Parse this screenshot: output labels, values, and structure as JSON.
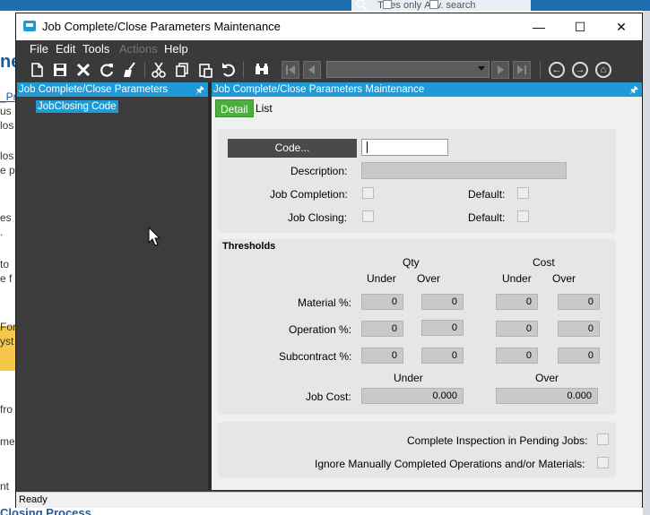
{
  "background": {
    "search_options": [
      "Titles only",
      "Adv. search"
    ],
    "left_fragments": [
      "ne",
      "_Pr",
      "us",
      "los",
      "los",
      "e p",
      "es",
      ".",
      " to",
      "e f",
      "For",
      "yst",
      " fro",
      "me",
      "nt"
    ],
    "bottom_text": "Closing Process"
  },
  "window": {
    "title": "Job Complete/Close Parameters Maintenance",
    "controls": {
      "minimize": "—",
      "maximize": "☐",
      "close": "✕"
    }
  },
  "menu": {
    "items": [
      {
        "label": "File",
        "enabled": true
      },
      {
        "label": "Edit",
        "enabled": true
      },
      {
        "label": "Tools",
        "enabled": true
      },
      {
        "label": "Actions",
        "enabled": false
      },
      {
        "label": "Help",
        "enabled": true
      }
    ]
  },
  "toolbar": {
    "icons": [
      "new-icon",
      "save-icon",
      "delete-icon",
      "refresh-icon",
      "clear-icon",
      "cut-icon",
      "copy-icon",
      "paste-icon",
      "undo-icon",
      "search-icon",
      "first-icon",
      "previous-icon",
      "navigation-combo",
      "next-icon",
      "last-icon",
      "back-icon",
      "forward-icon",
      "home-icon"
    ],
    "navigation_value": ""
  },
  "tree_panel": {
    "header": "Job Complete/Close Parameters",
    "items": [
      {
        "label": "JobClosing Code",
        "selected": true
      }
    ]
  },
  "detail_panel": {
    "header": "Job Complete/Close Parameters Maintenance",
    "tabs": [
      {
        "label": "Detail",
        "active": true
      },
      {
        "label": "List",
        "active": false
      }
    ],
    "code_button": "Code...",
    "code_value": "",
    "description_label": "Description:",
    "description_value": "",
    "job_completion_label": "Job Completion:",
    "job_closing_label": "Job Closing:",
    "default_label": "Default:",
    "thresholds": {
      "title": "Thresholds",
      "qty_label": "Qty",
      "cost_label": "Cost",
      "under_label": "Under",
      "over_label": "Over",
      "rows": [
        {
          "label": "Material %:",
          "qty_under": "0",
          "qty_over": "0",
          "cost_under": "0",
          "cost_over": "0"
        },
        {
          "label": "Operation %:",
          "qty_under": "0",
          "qty_over": "0",
          "cost_under": "0",
          "cost_over": "0"
        },
        {
          "label": "Subcontract %:",
          "qty_under": "0",
          "qty_over": "0",
          "cost_under": "0",
          "cost_over": "0"
        }
      ],
      "job_cost_label": "Job Cost:",
      "job_cost_under": "0.000",
      "job_cost_over": "0.000"
    },
    "options": {
      "complete_inspection_label": "Complete Inspection in Pending Jobs:",
      "ignore_manual_label": "Ignore Manually Completed Operations and/or Materials:"
    }
  },
  "status": {
    "text": "Ready"
  },
  "colors": {
    "accent": "#1f9ad6",
    "active_tab": "#4cae3f",
    "chrome": "#3a3a3a"
  }
}
